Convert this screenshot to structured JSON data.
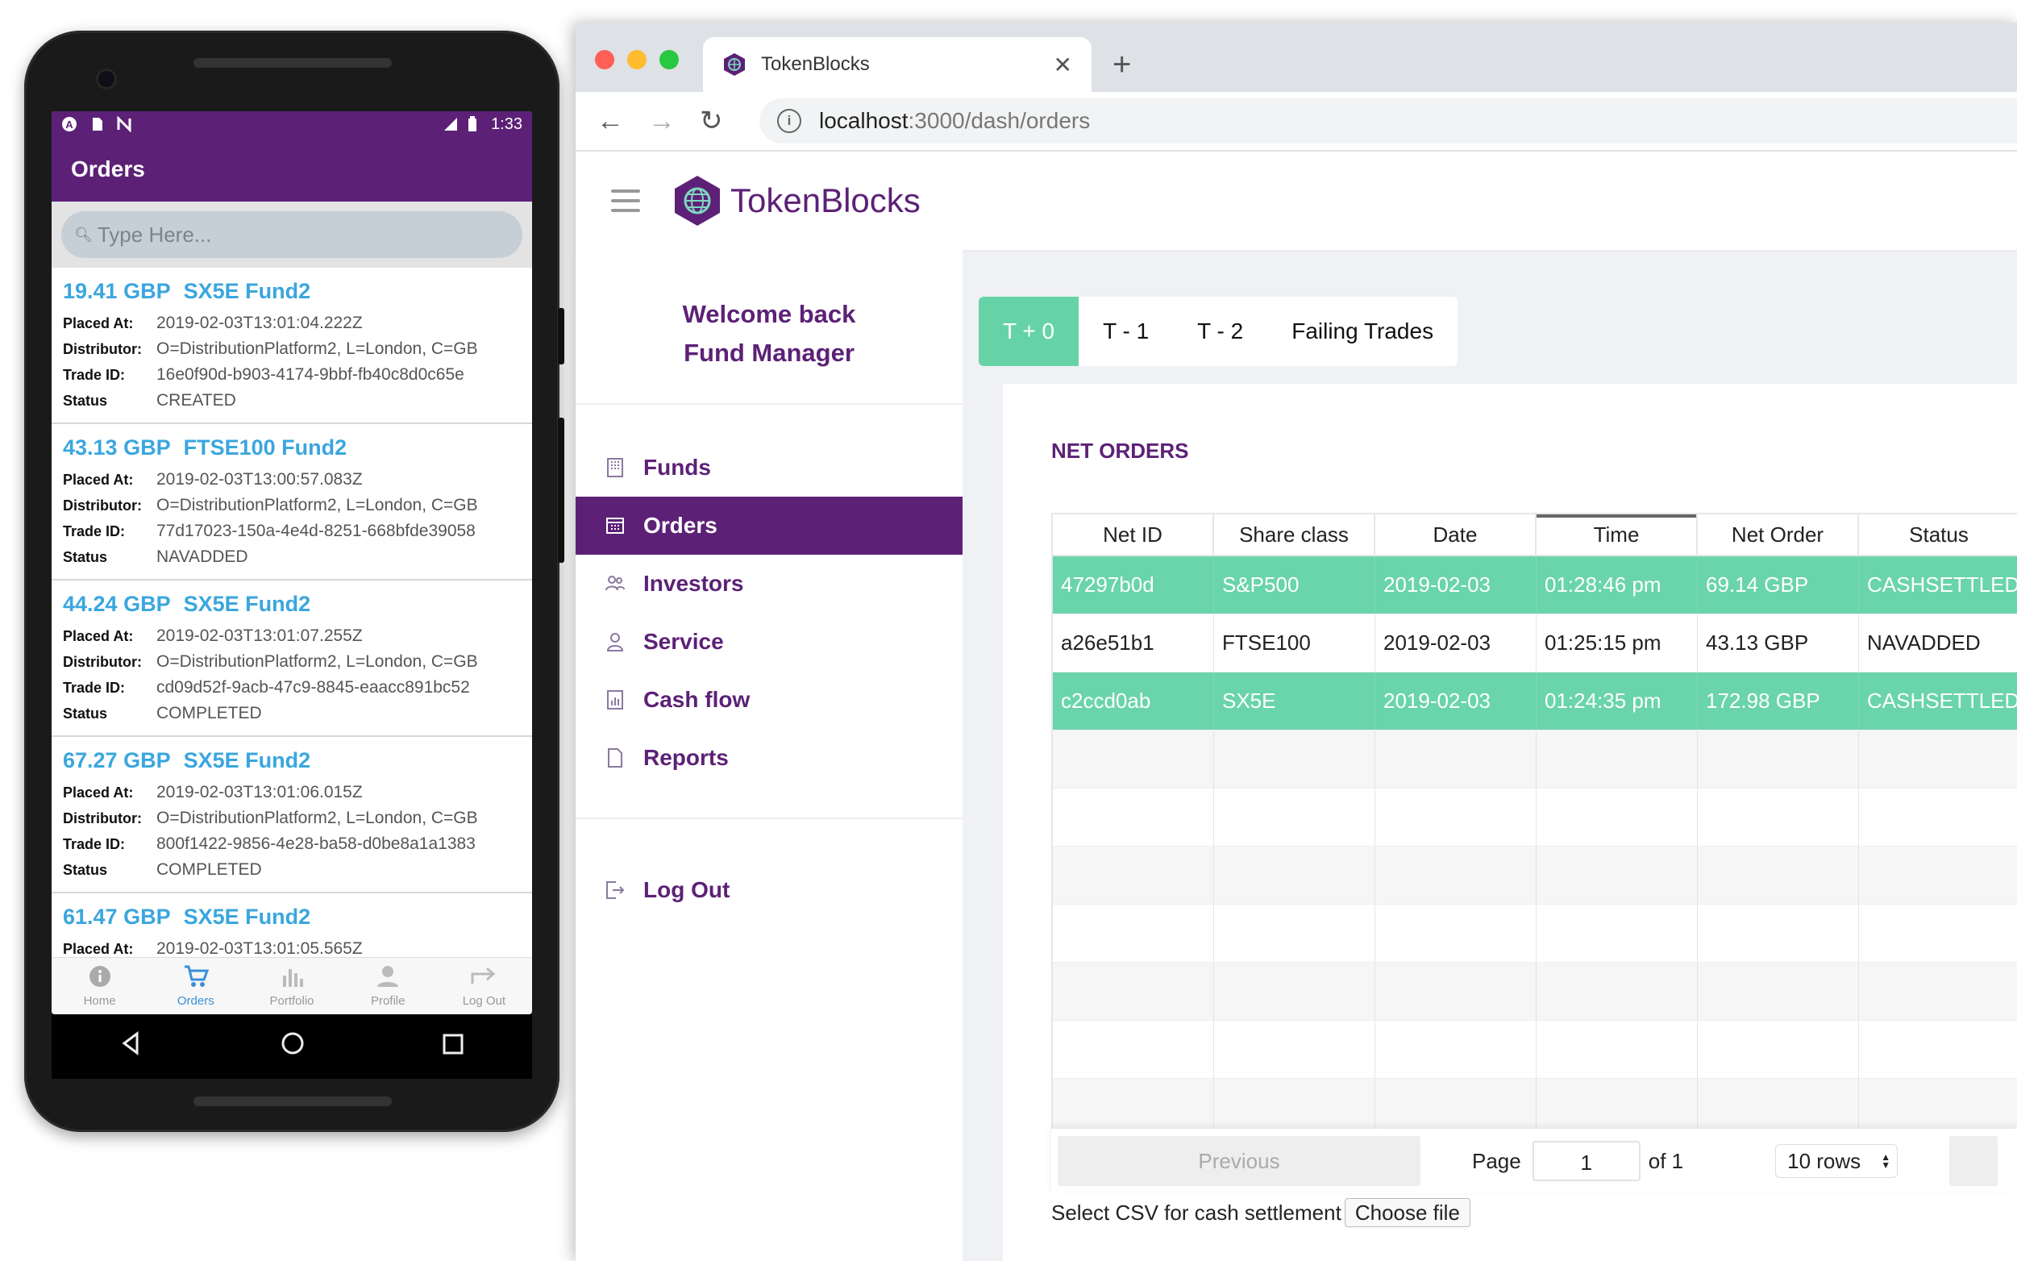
{
  "phone": {
    "status_time": "1:33",
    "appbar_title": "Orders",
    "search_placeholder": "Type Here...",
    "labels": {
      "placed": "Placed At:",
      "distributor": "Distributor:",
      "trade_id": "Trade ID:",
      "status": "Status"
    },
    "orders": [
      {
        "amount": "19.41 GBP",
        "fund": "SX5E Fund2",
        "placed_at": "2019-02-03T13:01:04.222Z",
        "distributor": "O=DistributionPlatform2, L=London, C=GB",
        "trade_id": "16e0f90d-b903-4174-9bbf-fb40c8d0c65e",
        "status": "CREATED"
      },
      {
        "amount": "43.13 GBP",
        "fund": "FTSE100 Fund2",
        "placed_at": "2019-02-03T13:00:57.083Z",
        "distributor": "O=DistributionPlatform2, L=London, C=GB",
        "trade_id": "77d17023-150a-4e4d-8251-668bfde39058",
        "status": "NAVADDED"
      },
      {
        "amount": "44.24 GBP",
        "fund": "SX5E Fund2",
        "placed_at": "2019-02-03T13:01:07.255Z",
        "distributor": "O=DistributionPlatform2, L=London, C=GB",
        "trade_id": "cd09d52f-9acb-47c9-8845-eaacc891bc52",
        "status": "COMPLETED"
      },
      {
        "amount": "67.27 GBP",
        "fund": "SX5E Fund2",
        "placed_at": "2019-02-03T13:01:06.015Z",
        "distributor": "O=DistributionPlatform2, L=London, C=GB",
        "trade_id": "800f1422-9856-4e28-ba58-d0be8a1a1383",
        "status": "COMPLETED"
      },
      {
        "amount": "61.47 GBP",
        "fund": "SX5E Fund2",
        "placed_at": "2019-02-03T13:01:05.565Z"
      }
    ],
    "tabs": [
      {
        "label": "Home",
        "icon": "info-icon"
      },
      {
        "label": "Orders",
        "icon": "cart-icon"
      },
      {
        "label": "Portfolio",
        "icon": "bar-chart-icon"
      },
      {
        "label": "Profile",
        "icon": "person-icon"
      },
      {
        "label": "Log Out",
        "icon": "logout-arrow-icon"
      }
    ],
    "active_tab": "Orders",
    "accent": "#5c2176",
    "link_color": "#3aa6de"
  },
  "browser": {
    "tab_title": "TokenBlocks",
    "url_host": "localhost",
    "url_path": ":3000/dash/orders"
  },
  "app": {
    "brand": "TokenBlocks",
    "welcome_line1": "Welcome back",
    "welcome_line2": "Fund Manager",
    "menu": [
      {
        "label": "Funds",
        "icon": "building-icon"
      },
      {
        "label": "Orders",
        "icon": "orders-icon"
      },
      {
        "label": "Investors",
        "icon": "people-icon"
      },
      {
        "label": "Service",
        "icon": "user-icon"
      },
      {
        "label": "Cash flow",
        "icon": "chart-icon"
      },
      {
        "label": "Reports",
        "icon": "document-icon"
      }
    ],
    "active_menu": "Orders",
    "logout": "Log Out",
    "tabs": [
      "T + 0",
      "T - 1",
      "T - 2",
      "Failing Trades"
    ],
    "active_tab": "T + 0",
    "section_title": "NET ORDERS",
    "columns": [
      "Net ID",
      "Share class",
      "Date",
      "Time",
      "Net Order",
      "Status"
    ],
    "sorted_column": "Time",
    "rows": [
      {
        "net_id": "47297b0d",
        "share_class": "S&P500",
        "date": "2019-02-03",
        "time": "01:28:46 pm",
        "net_order": "69.14 GBP",
        "status": "CASHSETTLED",
        "highlight": true
      },
      {
        "net_id": "a26e51b1",
        "share_class": "FTSE100",
        "date": "2019-02-03",
        "time": "01:25:15 pm",
        "net_order": "43.13 GBP",
        "status": "NAVADDED",
        "highlight": false
      },
      {
        "net_id": "c2ccd0ab",
        "share_class": "SX5E",
        "date": "2019-02-03",
        "time": "01:24:35 pm",
        "net_order": "172.98 GBP",
        "status": "CASHSETTLED",
        "highlight": true
      }
    ],
    "empty_rows": 7,
    "pager": {
      "previous": "Previous",
      "page_label": "Page",
      "page_value": "1",
      "of_label": "of 1",
      "rows_value": "10 rows"
    },
    "csv_label": "Select CSV for cash settlement",
    "choose_file": "Choose file",
    "highlight_color": "#6ad4ab",
    "brand_color": "#5c2176"
  }
}
